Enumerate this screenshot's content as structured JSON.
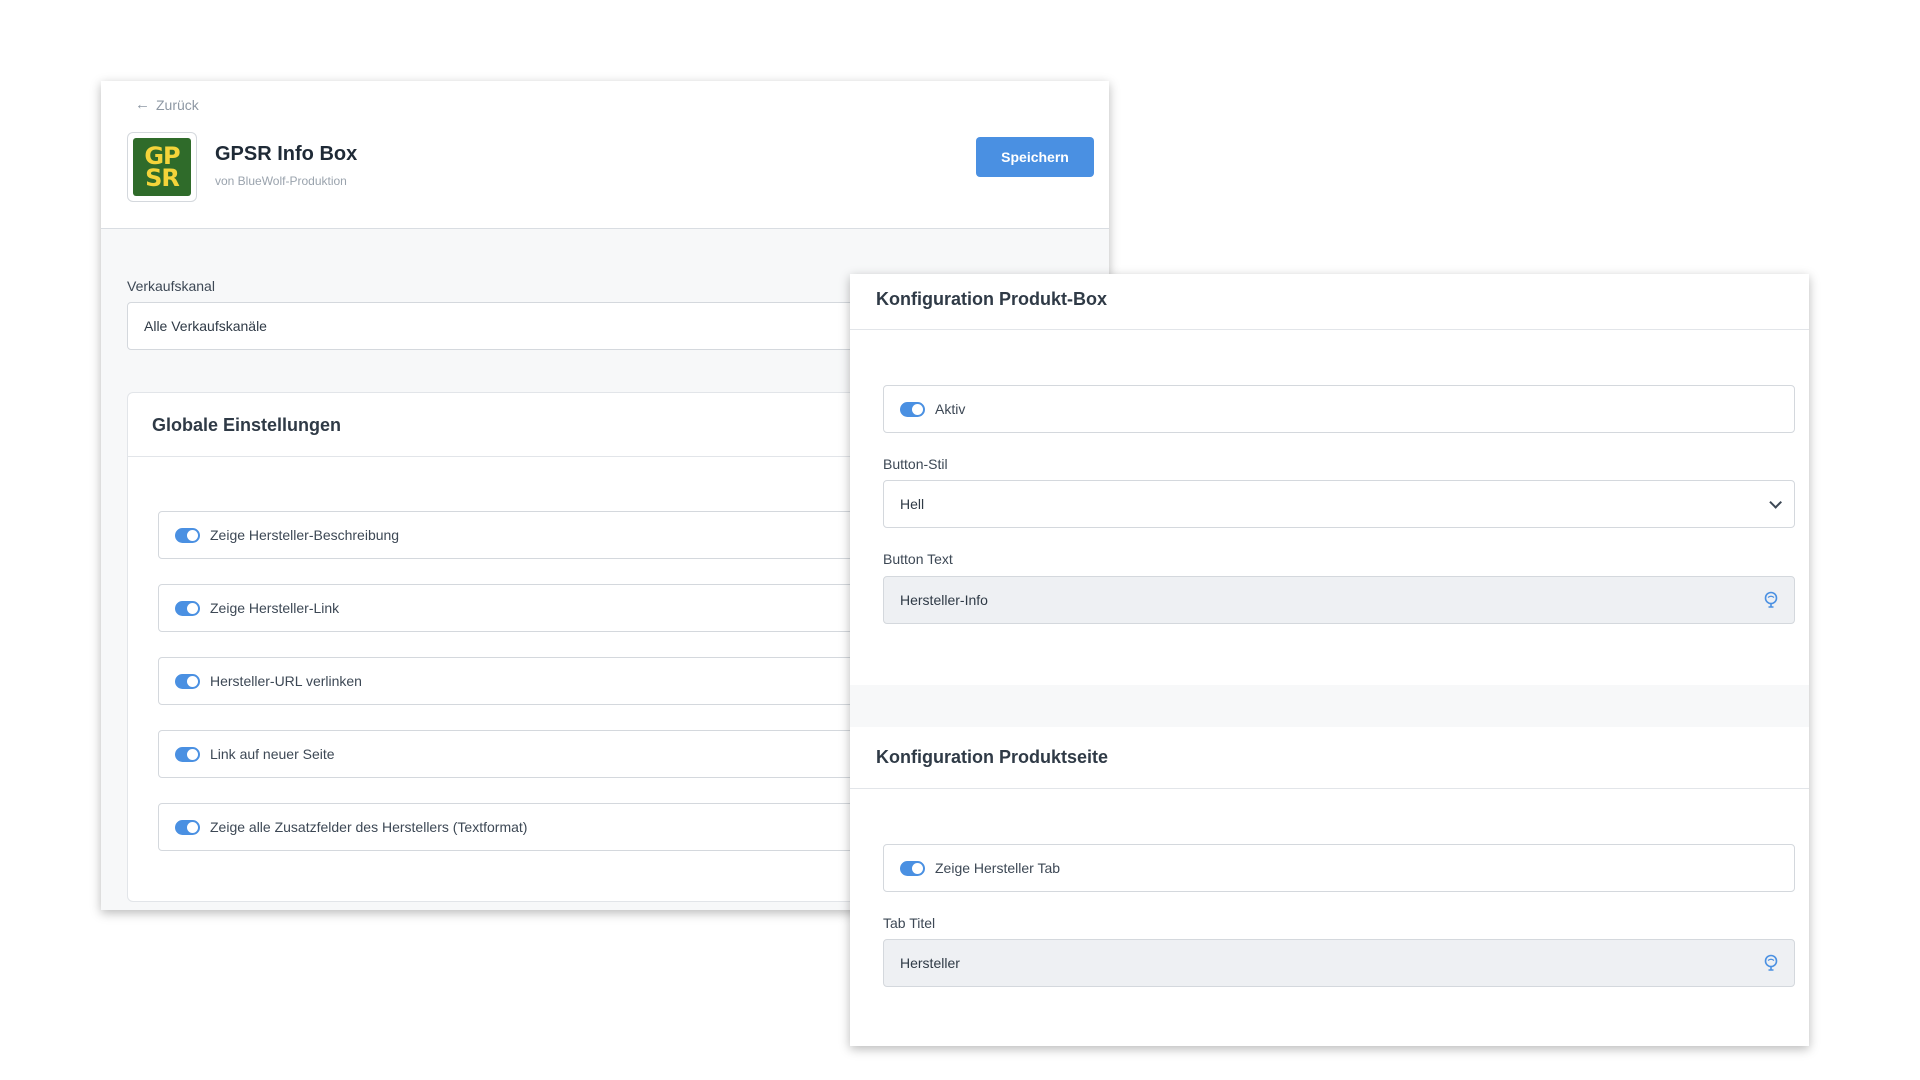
{
  "header": {
    "back_label": "Zurück",
    "app_title": "GPSR Info Box",
    "app_author": "von BlueWolf-Produktion",
    "logo_text_top": "GP",
    "logo_text_bottom": "SR",
    "save_label": "Speichern"
  },
  "sales_channel": {
    "label": "Verkaufskanal",
    "value": "Alle Verkaufskanäle"
  },
  "global_settings": {
    "title": "Globale Einstellungen",
    "toggles": [
      {
        "label": "Zeige Hersteller-Beschreibung",
        "on": true
      },
      {
        "label": "Zeige Hersteller-Link",
        "on": true
      },
      {
        "label": "Hersteller-URL verlinken",
        "on": true
      },
      {
        "label": "Link auf neuer Seite",
        "on": true
      },
      {
        "label": "Zeige alle Zusatzfelder des Herstellers (Textformat)",
        "on": true
      }
    ]
  },
  "product_box": {
    "title": "Konfiguration Produkt-Box",
    "active_label": "Aktiv",
    "active_on": true,
    "button_style_label": "Button-Stil",
    "button_style_value": "Hell",
    "button_text_label": "Button Text",
    "button_text_value": "Hersteller-Info"
  },
  "product_page": {
    "title": "Konfiguration Produktseite",
    "tab_toggle_label": "Zeige Hersteller Tab",
    "tab_toggle_on": true,
    "tab_title_label": "Tab Titel",
    "tab_title_value": "Hersteller"
  },
  "colors": {
    "accent": "#4a90e2",
    "logo_bg": "#2f6b2a",
    "logo_text": "#f4d43a"
  }
}
